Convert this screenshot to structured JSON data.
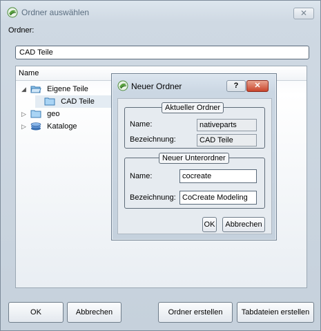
{
  "window": {
    "title": "Ordner auswählen",
    "close_glyph": "✕",
    "folder_label": "Ordner:",
    "path_value": "CAD Teile"
  },
  "tree": {
    "column_header": "Name",
    "items": [
      {
        "label": "Eigene Teile",
        "expander": "◢",
        "icon": "folder-open-icon"
      },
      {
        "label": "CAD Teile",
        "expander": "",
        "icon": "folder-icon"
      },
      {
        "label": "geo",
        "expander": "▷",
        "icon": "folder-icon"
      },
      {
        "label": "Kataloge",
        "expander": "▷",
        "icon": "catalog-icon"
      }
    ]
  },
  "buttons": {
    "ok": "OK",
    "cancel": "Abbrechen",
    "create_folder": "Ordner erstellen",
    "create_tables": "Tabdateien erstellen"
  },
  "dialog": {
    "title": "Neuer Ordner",
    "help_glyph": "?",
    "close_glyph": "✕",
    "current": {
      "group_title": "Aktueller Ordner",
      "name_label": "Name:",
      "name_value": "nativeparts",
      "desc_label": "Bezeichnung:",
      "desc_value": "CAD Teile"
    },
    "new": {
      "group_title": "Neuer Unterordner",
      "name_label": "Name:",
      "name_value": "cocreate",
      "desc_label": "Bezeichnung:",
      "desc_value": "CoCreate Modeling"
    },
    "ok": "OK",
    "cancel": "Abbrechen"
  }
}
